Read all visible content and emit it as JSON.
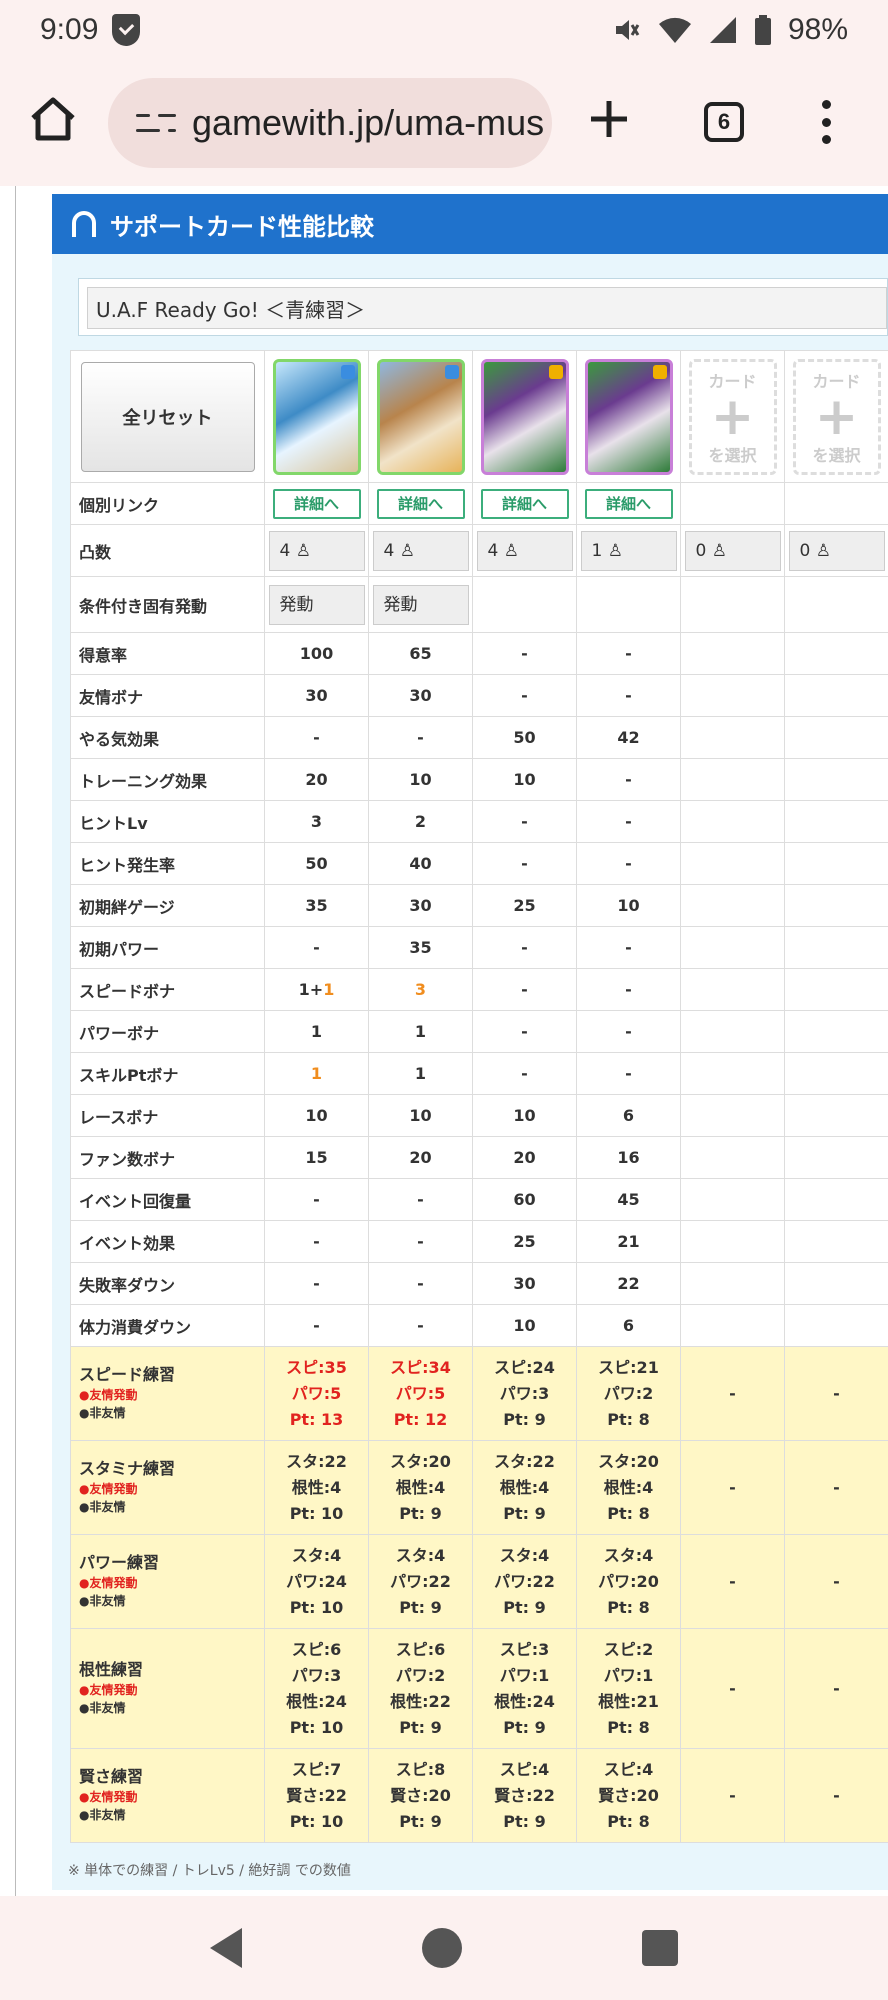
{
  "status": {
    "time": "9:09",
    "battery": "98%"
  },
  "browser": {
    "url": "gamewith.jp/uma-mus",
    "tab_count": "6"
  },
  "panel": {
    "title": "サポートカード性能比較",
    "card_name": "U.A.F Ready Go! ＜青練習＞"
  },
  "controls": {
    "reset_label": "全リセット",
    "slot_top": "カード",
    "slot_bottom": "を選択",
    "slot_plus": "+"
  },
  "labels": {
    "link": "個別リンク",
    "limit_break": "凸数",
    "conditional": "条件付き固有発動",
    "friend_active": "●友情発動",
    "non_friend": "●非友情"
  },
  "link_label": "詳細へ",
  "limit_break": [
    "4",
    "4",
    "4",
    "1",
    "0",
    "0"
  ],
  "conditional": [
    "発動",
    "発動",
    "",
    "",
    "",
    ""
  ],
  "stats": [
    {
      "name": "得意率",
      "values": [
        "100",
        "65",
        "-",
        "-",
        "",
        ""
      ]
    },
    {
      "name": "友情ボナ",
      "values": [
        "30",
        "30",
        "-",
        "-",
        "",
        ""
      ]
    },
    {
      "name": "やる気効果",
      "values": [
        "-",
        "-",
        "50",
        "42",
        "",
        ""
      ]
    },
    {
      "name": "トレーニング効果",
      "values": [
        "20",
        "10",
        "10",
        "-",
        "",
        ""
      ]
    },
    {
      "name": "ヒントLv",
      "values": [
        "3",
        "2",
        "-",
        "-",
        "",
        ""
      ]
    },
    {
      "name": "ヒント発生率",
      "values": [
        "50",
        "40",
        "-",
        "-",
        "",
        ""
      ]
    },
    {
      "name": "初期絆ゲージ",
      "values": [
        "35",
        "30",
        "25",
        "10",
        "",
        ""
      ]
    },
    {
      "name": "初期パワー",
      "values": [
        "-",
        "35",
        "-",
        "-",
        "",
        ""
      ]
    },
    {
      "name": "スピードボナ",
      "values": [
        "1+",
        "3",
        "-",
        "-",
        "",
        ""
      ],
      "extra": "1"
    },
    {
      "name": "パワーボナ",
      "values": [
        "1",
        "1",
        "-",
        "-",
        "",
        ""
      ]
    },
    {
      "name": "スキルPtボナ",
      "values": [
        "1",
        "1",
        "-",
        "-",
        "",
        ""
      ]
    },
    {
      "name": "レースボナ",
      "values": [
        "10",
        "10",
        "10",
        "6",
        "",
        ""
      ]
    },
    {
      "name": "ファン数ボナ",
      "values": [
        "15",
        "20",
        "20",
        "16",
        "",
        ""
      ]
    },
    {
      "name": "イベント回復量",
      "values": [
        "-",
        "-",
        "60",
        "45",
        "",
        ""
      ]
    },
    {
      "name": "イベント効果",
      "values": [
        "-",
        "-",
        "25",
        "21",
        "",
        ""
      ]
    },
    {
      "name": "失敗率ダウン",
      "values": [
        "-",
        "-",
        "30",
        "22",
        "",
        ""
      ]
    },
    {
      "name": "体力消費ダウン",
      "values": [
        "-",
        "-",
        "10",
        "6",
        "",
        ""
      ]
    }
  ],
  "training": [
    {
      "name": "スピード練習",
      "cells": [
        [
          "スピ:35",
          "パワ:5",
          "Pt: 13"
        ],
        [
          "スピ:34",
          "パワ:5",
          "Pt: 12"
        ],
        [
          "スピ:24",
          "パワ:3",
          "Pt: 9"
        ],
        [
          "スピ:21",
          "パワ:2",
          "Pt: 8"
        ],
        [
          "-"
        ],
        [
          "-"
        ]
      ]
    },
    {
      "name": "スタミナ練習",
      "cells": [
        [
          "スタ:22",
          "根性:4",
          "Pt: 10"
        ],
        [
          "スタ:20",
          "根性:4",
          "Pt: 9"
        ],
        [
          "スタ:22",
          "根性:4",
          "Pt: 9"
        ],
        [
          "スタ:20",
          "根性:4",
          "Pt: 8"
        ],
        [
          "-"
        ],
        [
          "-"
        ]
      ]
    },
    {
      "name": "パワー練習",
      "cells": [
        [
          "スタ:4",
          "パワ:24",
          "Pt: 10"
        ],
        [
          "スタ:4",
          "パワ:22",
          "Pt: 9"
        ],
        [
          "スタ:4",
          "パワ:22",
          "Pt: 9"
        ],
        [
          "スタ:4",
          "パワ:20",
          "Pt: 8"
        ],
        [
          "-"
        ],
        [
          "-"
        ]
      ]
    },
    {
      "name": "根性練習",
      "cells": [
        [
          "スピ:6",
          "パワ:3",
          "根性:24",
          "Pt: 10"
        ],
        [
          "スピ:6",
          "パワ:2",
          "根性:22",
          "Pt: 9"
        ],
        [
          "スピ:3",
          "パワ:1",
          "根性:24",
          "Pt: 9"
        ],
        [
          "スピ:2",
          "パワ:1",
          "根性:21",
          "Pt: 8"
        ],
        [
          "-"
        ],
        [
          "-"
        ]
      ]
    },
    {
      "name": "賢さ練習",
      "cells": [
        [
          "スピ:7",
          "賢さ:22",
          "Pt: 10"
        ],
        [
          "スピ:8",
          "賢さ:20",
          "Pt: 9"
        ],
        [
          "スピ:4",
          "賢さ:22",
          "Pt: 9"
        ],
        [
          "スピ:4",
          "賢さ:20",
          "Pt: 8"
        ],
        [
          "-"
        ],
        [
          "-"
        ]
      ]
    }
  ],
  "footnote": "※ 単体での練習 / トレLv5 / 絶好調 での数値",
  "colors": {
    "header_blue": "#1f72cc",
    "highlight_orange": "#f08d1e",
    "highlight_red": "#e1231f",
    "training_bg": "#fff7c6"
  }
}
